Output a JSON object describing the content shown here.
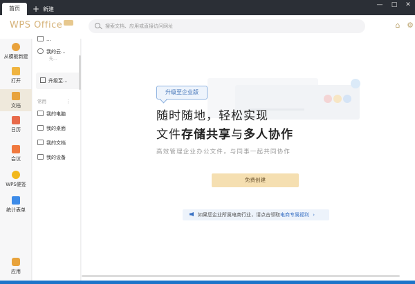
{
  "titlebar": {
    "tab_home": "首页",
    "tab_new": "新建",
    "controls": [
      "minimize-icon",
      "maximize-icon",
      "close-icon"
    ]
  },
  "header": {
    "logo": "WPS Office",
    "search_placeholder": "搜索文档、应用或直接访问网址",
    "icons": [
      "skin-icon",
      "settings-icon"
    ]
  },
  "leftnav": {
    "items": [
      {
        "label": "从模板新建",
        "icon": "template-icon",
        "color": "#e9a23b"
      },
      {
        "label": "打开",
        "icon": "folder-icon",
        "color": "#f0b440"
      },
      {
        "label": "文档",
        "icon": "document-icon",
        "color": "#e8a33c",
        "active": true
      },
      {
        "label": "日历",
        "icon": "calendar-icon",
        "color": "#e86a4a"
      },
      {
        "label": "会议",
        "icon": "meeting-icon",
        "color": "#f0793f"
      },
      {
        "label": "WPS便签",
        "icon": "note-icon",
        "color": "#f2b81c"
      },
      {
        "label": "统计表单",
        "icon": "form-icon",
        "color": "#3d8be8"
      },
      {
        "label": "应用",
        "icon": "apps-icon",
        "color": "#e8a33c"
      }
    ]
  },
  "midpanel": {
    "top_partial": "...",
    "cloud_label": "我的云...",
    "cloud_sub": "先...",
    "upgrade_label": "升级至...",
    "section": "常用",
    "items": [
      "我的电脑",
      "我的桌面",
      "我的文档",
      "我的设备"
    ]
  },
  "main": {
    "badge": "升级至企业版",
    "headline1": "随时随地，轻松实现",
    "headline2_a": "文件",
    "headline2_b": "存储共享",
    "headline2_c": "与",
    "headline2_d": "多人协作",
    "subline": "高效管理企业办公文件，与同事一起共同协作",
    "create_button": "免费创建",
    "notice_text": "如果您企业所属电商行业，请点击领取",
    "notice_link": "电商专属福利",
    "notice_tail": "›"
  },
  "colors": {
    "titlebar": "#2b2f36",
    "accent_gold": "#d6b37a",
    "create_button": "#f5dfb1",
    "link_blue": "#3a72c4"
  }
}
